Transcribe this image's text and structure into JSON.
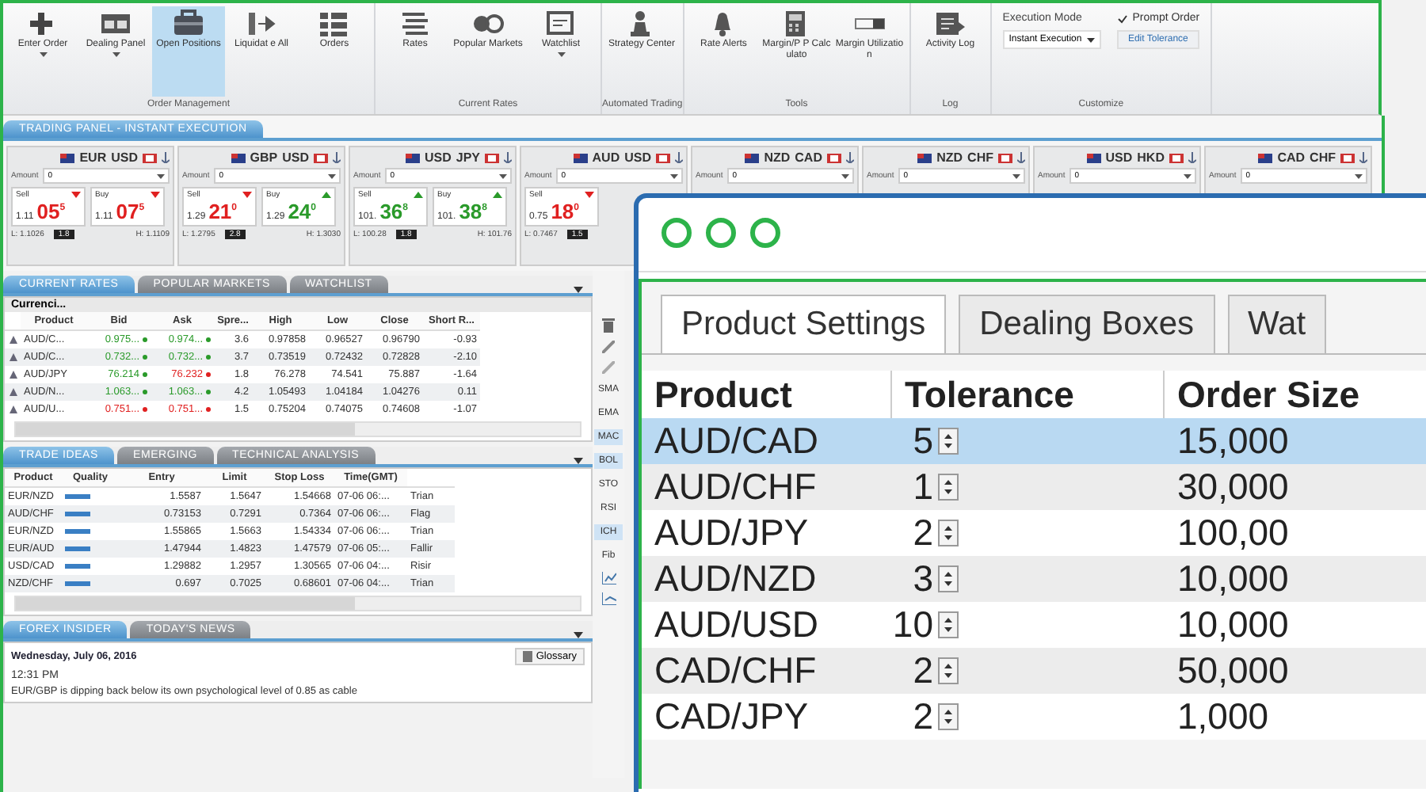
{
  "ribbon": {
    "groups": [
      {
        "kind": "buttons",
        "label": "Order Management",
        "buttons": [
          {
            "label": "Enter Order",
            "dropdown": true,
            "selected": false
          },
          {
            "label": "Dealing Panel",
            "dropdown": true,
            "selected": false
          },
          {
            "label": "Open Positions",
            "dropdown": false,
            "selected": true
          },
          {
            "label": "Liquidat e All",
            "dropdown": false,
            "selected": false
          },
          {
            "label": "Orders",
            "dropdown": false,
            "selected": false
          }
        ]
      },
      {
        "kind": "buttons",
        "label": "Current Rates",
        "buttons": [
          {
            "label": "Rates",
            "dropdown": false,
            "selected": false
          },
          {
            "label": "Popular Markets",
            "dropdown": false,
            "selected": false
          },
          {
            "label": "Watchlist",
            "dropdown": true,
            "selected": false
          }
        ]
      },
      {
        "kind": "buttons",
        "label": "Automated Trading",
        "buttons": [
          {
            "label": "Strategy Center",
            "dropdown": false,
            "selected": false
          }
        ]
      },
      {
        "kind": "buttons",
        "label": "Tools",
        "buttons": [
          {
            "label": "Rate Alerts",
            "dropdown": false,
            "selected": false
          },
          {
            "label": "Margin/P P Calculato",
            "dropdown": false,
            "selected": false
          },
          {
            "label": "Margin Utilizatio n",
            "dropdown": false,
            "selected": false
          }
        ]
      },
      {
        "kind": "buttons",
        "label": "Log",
        "buttons": [
          {
            "label": "Activity Log",
            "dropdown": false,
            "selected": false
          }
        ]
      },
      {
        "kind": "customize",
        "label": "Customize",
        "mode_label": "Execution Mode",
        "mode_value": "Instant Execution",
        "prompt": {
          "label": "Prompt Order",
          "checked": true
        },
        "edit_button": "Edit Tolerance"
      }
    ]
  },
  "trading_panel": {
    "title": "TRADING PANEL - INSTANT EXECUTION",
    "tiles": [
      {
        "base": "EUR",
        "quote": "USD",
        "amount_label": "Amount",
        "amount": "0",
        "quotes": [
          {
            "label": "Sell",
            "big": "1.11",
            "pips": "05$^{5}$",
            "rising": false
          },
          {
            "label": "Buy",
            "big": "1.11",
            "pips": "07$^{5}$",
            "rising": false
          }
        ],
        "low": "L: 1.1026",
        "spread": "1.8",
        "high": "H: 1.1109"
      },
      {
        "base": "GBP",
        "quote": "USD",
        "amount_label": "Amount",
        "amount": "0",
        "quotes": [
          {
            "label": "Sell",
            "big": "1.29",
            "pips": "21$^{0}$",
            "rising": false
          },
          {
            "label": "Buy",
            "big": "1.29",
            "pips": "24$^{0}$",
            "rising": true
          }
        ],
        "low": "L: 1.2795",
        "spread": "2.8",
        "high": "H: 1.3030"
      },
      {
        "base": "USD",
        "quote": "JPY",
        "amount_label": "Amount",
        "amount": "0",
        "quotes": [
          {
            "label": "Sell",
            "big": "101.",
            "pips": "36$^{8}$",
            "rising": true
          },
          {
            "label": "Buy",
            "big": "101.",
            "pips": "38$^{8}$",
            "rising": true
          }
        ],
        "low": "L: 100.28",
        "spread": "1.8",
        "high": "H: 101.76"
      },
      {
        "base": "AUD",
        "quote": "USD",
        "amount_label": "Amount",
        "amount": "0",
        "quotes": [
          {
            "label": "Sell",
            "big": "0.75",
            "pips": "18$^{0}$",
            "rising": false
          }
        ],
        "low": "L: 0.7467",
        "spread": "1.5"
      },
      {
        "base": "NZD",
        "quote": "CAD",
        "amount_label": "Amount",
        "amount": "0"
      },
      {
        "base": "NZD",
        "quote": "CHF",
        "amount_label": "Amount",
        "amount": "0"
      },
      {
        "base": "USD",
        "quote": "HKD",
        "amount_label": "Amount",
        "amount": "0"
      },
      {
        "base": "CAD",
        "quote": "CHF",
        "amount_label": "Amount",
        "amount": "0"
      }
    ]
  },
  "current_rates": {
    "tabs": [
      {
        "label": "CURRENT RATES",
        "selected": true
      },
      {
        "label": "POPULAR MARKETS",
        "selected": false
      },
      {
        "label": "WATCHLIST",
        "selected": false
      }
    ],
    "group": "Currenci...",
    "columns": [
      "Product",
      "Bid",
      "Ask",
      "Spre...",
      "High",
      "Low",
      "Close",
      "Short R..."
    ],
    "rows": [
      {
        "product": "AUD/C...",
        "bid": "0.975...",
        "bid_up": true,
        "ask": "0.974...",
        "ask_up": true,
        "spread": "3.6",
        "high": "0.97858",
        "low": "0.96527",
        "close": "0.96790",
        "short": "-0.93"
      },
      {
        "product": "AUD/C...",
        "bid": "0.732...",
        "bid_up": true,
        "ask": "0.732...",
        "ask_up": true,
        "spread": "3.7",
        "high": "0.73519",
        "low": "0.72432",
        "close": "0.72828",
        "short": "-2.10"
      },
      {
        "product": "AUD/JPY",
        "bid": "76.214",
        "bid_up": true,
        "ask": "76.232",
        "ask_up": false,
        "spread": "1.8",
        "high": "76.278",
        "low": "74.541",
        "close": "75.887",
        "short": "-1.64"
      },
      {
        "product": "AUD/N...",
        "bid": "1.063...",
        "bid_up": true,
        "ask": "1.063...",
        "ask_up": true,
        "spread": "4.2",
        "high": "1.05493",
        "low": "1.04184",
        "close": "1.04276",
        "short": "0.11"
      },
      {
        "product": "AUD/U...",
        "bid": "0.751...",
        "bid_up": false,
        "ask": "0.751...",
        "ask_up": false,
        "spread": "1.5",
        "high": "0.75204",
        "low": "0.74075",
        "close": "0.74608",
        "short": "-1.07"
      }
    ]
  },
  "indicators": [
    {
      "label": "SMA",
      "highlighted": false
    },
    {
      "label": "EMA",
      "highlighted": false
    },
    {
      "label": "MAC",
      "highlighted": true
    },
    {
      "label": "BOL",
      "highlighted": true
    },
    {
      "label": "STO",
      "highlighted": false
    },
    {
      "label": "RSI",
      "highlighted": false
    },
    {
      "label": "ICH",
      "highlighted": true
    },
    {
      "label": "Fib",
      "highlighted": false
    }
  ],
  "trade_ideas": {
    "tabs": [
      {
        "label": "TRADE IDEAS",
        "selected": true
      },
      {
        "label": "EMERGING",
        "selected": false
      },
      {
        "label": "TECHNICAL ANALYSIS",
        "selected": false
      }
    ],
    "columns": [
      "Product",
      "Quality",
      "Entry",
      "Limit",
      "Stop Loss",
      "Time(GMT)"
    ],
    "rows": [
      {
        "product": "EUR/NZD",
        "entry": "1.5587",
        "limit": "1.5647",
        "stop": "1.54668",
        "time": "07-06 06:...",
        "column_7": "Trian"
      },
      {
        "product": "AUD/CHF",
        "entry": "0.73153",
        "limit": "0.7291",
        "stop": "0.7364",
        "time": "07-06 06:...",
        "column_7": "Flag"
      },
      {
        "product": "EUR/NZD",
        "entry": "1.55865",
        "limit": "1.5663",
        "stop": "1.54334",
        "time": "07-06 06:...",
        "column_7": "Trian"
      },
      {
        "product": "EUR/AUD",
        "entry": "1.47944",
        "limit": "1.4823",
        "stop": "1.47579",
        "time": "07-06 05:...",
        "column_7": "Fallir"
      },
      {
        "product": "USD/CAD",
        "entry": "1.29882",
        "limit": "1.2957",
        "stop": "1.30565",
        "time": "07-06 04:...",
        "column_7": "Risir"
      },
      {
        "product": "NZD/CHF",
        "entry": "0.697",
        "limit": "0.7025",
        "stop": "0.68601",
        "time": "07-06 04:...",
        "column_7": "Trian"
      }
    ]
  },
  "news": {
    "tabs": [
      {
        "label": "FOREX INSIDER",
        "selected": true
      },
      {
        "label": "TODAY'S NEWS",
        "selected": false
      }
    ],
    "date": "Wednesday, July 06, 2016",
    "glossary": "Glossary",
    "time": "12:31 PM",
    "text": "EUR/GBP is dipping back below its own psychological level of 0.85 as cable"
  },
  "settings_window": {
    "tabs": [
      {
        "label": "Product Settings",
        "selected": true
      },
      {
        "label": "Dealing Boxes",
        "selected": false
      },
      {
        "label": "Wat",
        "selected": false
      }
    ],
    "columns": [
      "Product",
      "Tolerance",
      "Order Size"
    ],
    "rows": [
      {
        "product": "AUD/CAD",
        "tolerance": "5",
        "order_size": "15,000",
        "selected": true
      },
      {
        "product": "AUD/CHF",
        "tolerance": "1",
        "order_size": "30,000",
        "selected": false
      },
      {
        "product": "AUD/JPY",
        "tolerance": "2",
        "order_size": "100,00",
        "selected": false
      },
      {
        "product": "AUD/NZD",
        "tolerance": "3",
        "order_size": "10,000",
        "selected": false
      },
      {
        "product": "AUD/USD",
        "tolerance": "10",
        "order_size": "10,000",
        "selected": false
      },
      {
        "product": "CAD/CHF",
        "tolerance": "2",
        "order_size": "50,000",
        "selected": false
      },
      {
        "product": "CAD/JPY",
        "tolerance": "2",
        "order_size": "1,000",
        "selected": false
      }
    ]
  }
}
